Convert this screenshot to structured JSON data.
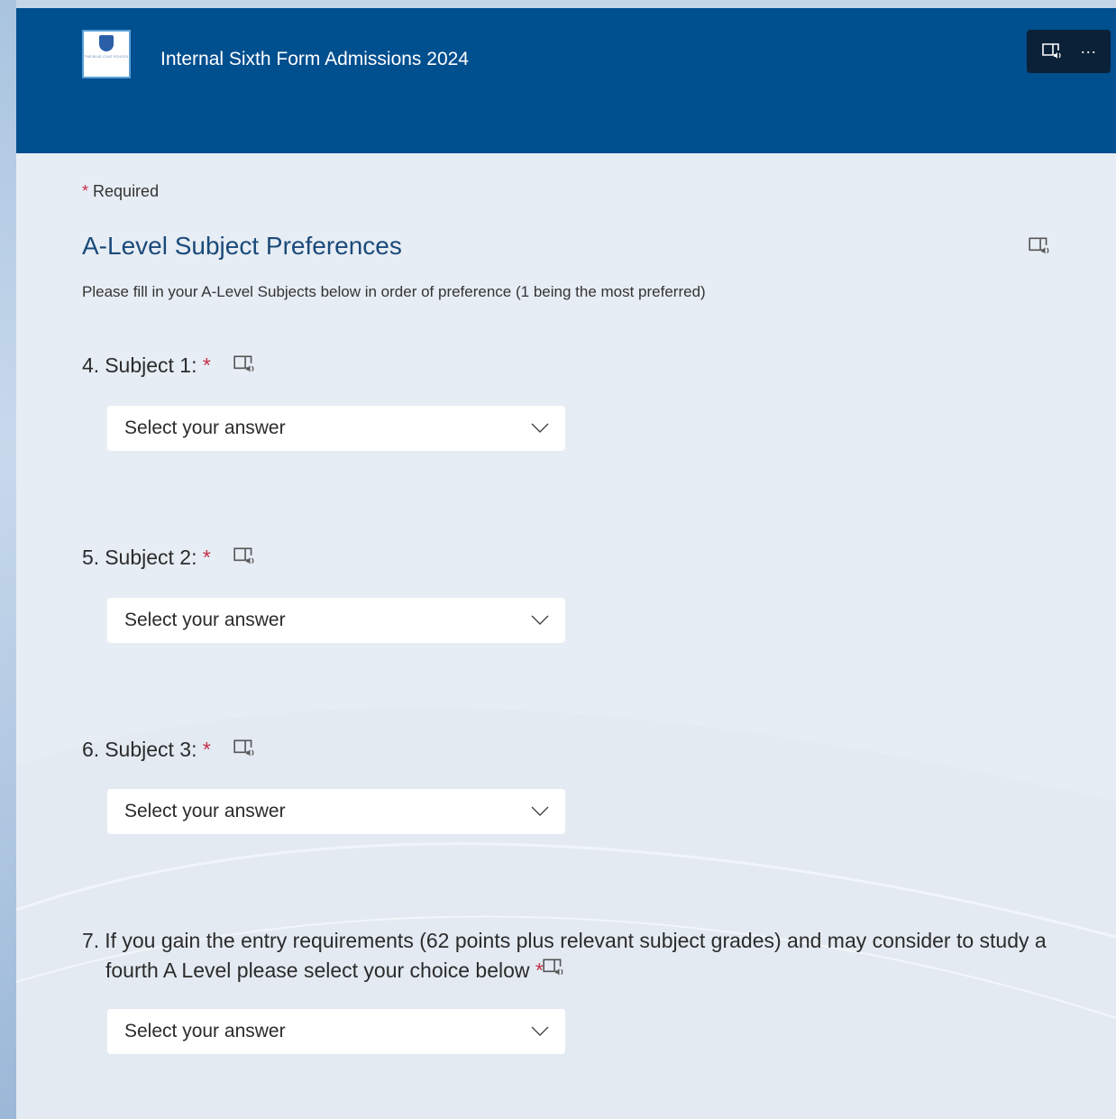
{
  "header": {
    "title": "Internal Sixth Form Admissions 2024",
    "logo_text": "THE BLUE COAT SCHOOL",
    "colors": {
      "header_bg": "#004f8f",
      "toolbar_bg": "#0b2138",
      "accent_title": "#1b4a7a",
      "required_star": "#c4314b"
    }
  },
  "toolbar": {
    "immersive_reader_icon": "immersive-reader-icon",
    "more_label": "···"
  },
  "form": {
    "required_star": "*",
    "required_label": "Required",
    "section_title": "A-Level Subject Preferences",
    "section_description": "Please fill in your A-Level Subjects below in order of preference (1 being the most preferred)",
    "questions": [
      {
        "number": "4.",
        "text": "Subject 1:",
        "star": "*",
        "placeholder": "Select your answer"
      },
      {
        "number": "5.",
        "text": "Subject 2:",
        "star": "*",
        "placeholder": "Select your answer"
      },
      {
        "number": "6.",
        "text": "Subject 3:",
        "star": "*",
        "placeholder": "Select your answer"
      },
      {
        "number": "7.",
        "text": "If you gain the entry requirements (62 points plus relevant subject grades) and may consider to study a fourth A Level please select your choice below",
        "star": "*",
        "placeholder": "Select your answer"
      }
    ]
  }
}
